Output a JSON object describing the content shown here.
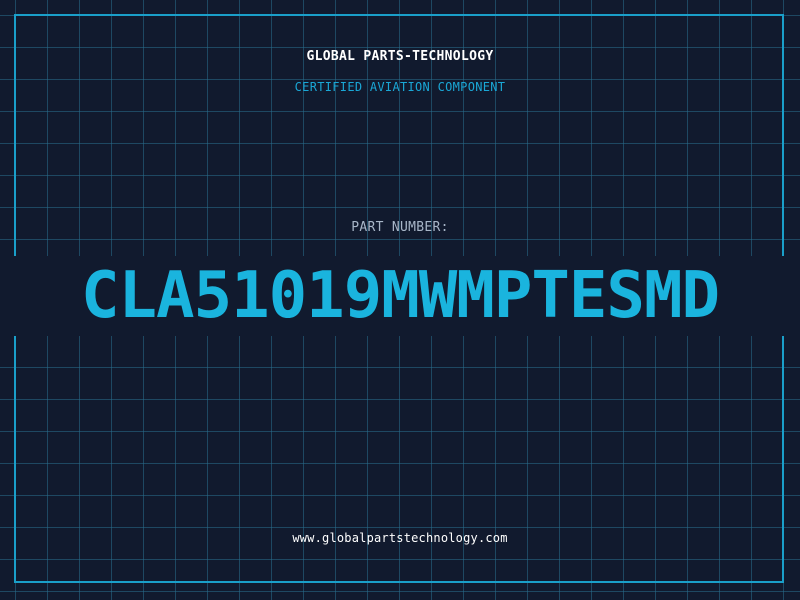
{
  "header": {
    "company": "GLOBAL PARTS-TECHNOLOGY",
    "tagline": "CERTIFIED AVIATION COMPONENT"
  },
  "part": {
    "label": "PART NUMBER:",
    "number": "CLA51019MWMPTESMD"
  },
  "footer": {
    "website": "www.globalpartstechnology.com"
  },
  "colors": {
    "background": "#111a2e",
    "grid": "#286e8c",
    "accent": "#1ab4de",
    "text": "#ffffff"
  }
}
